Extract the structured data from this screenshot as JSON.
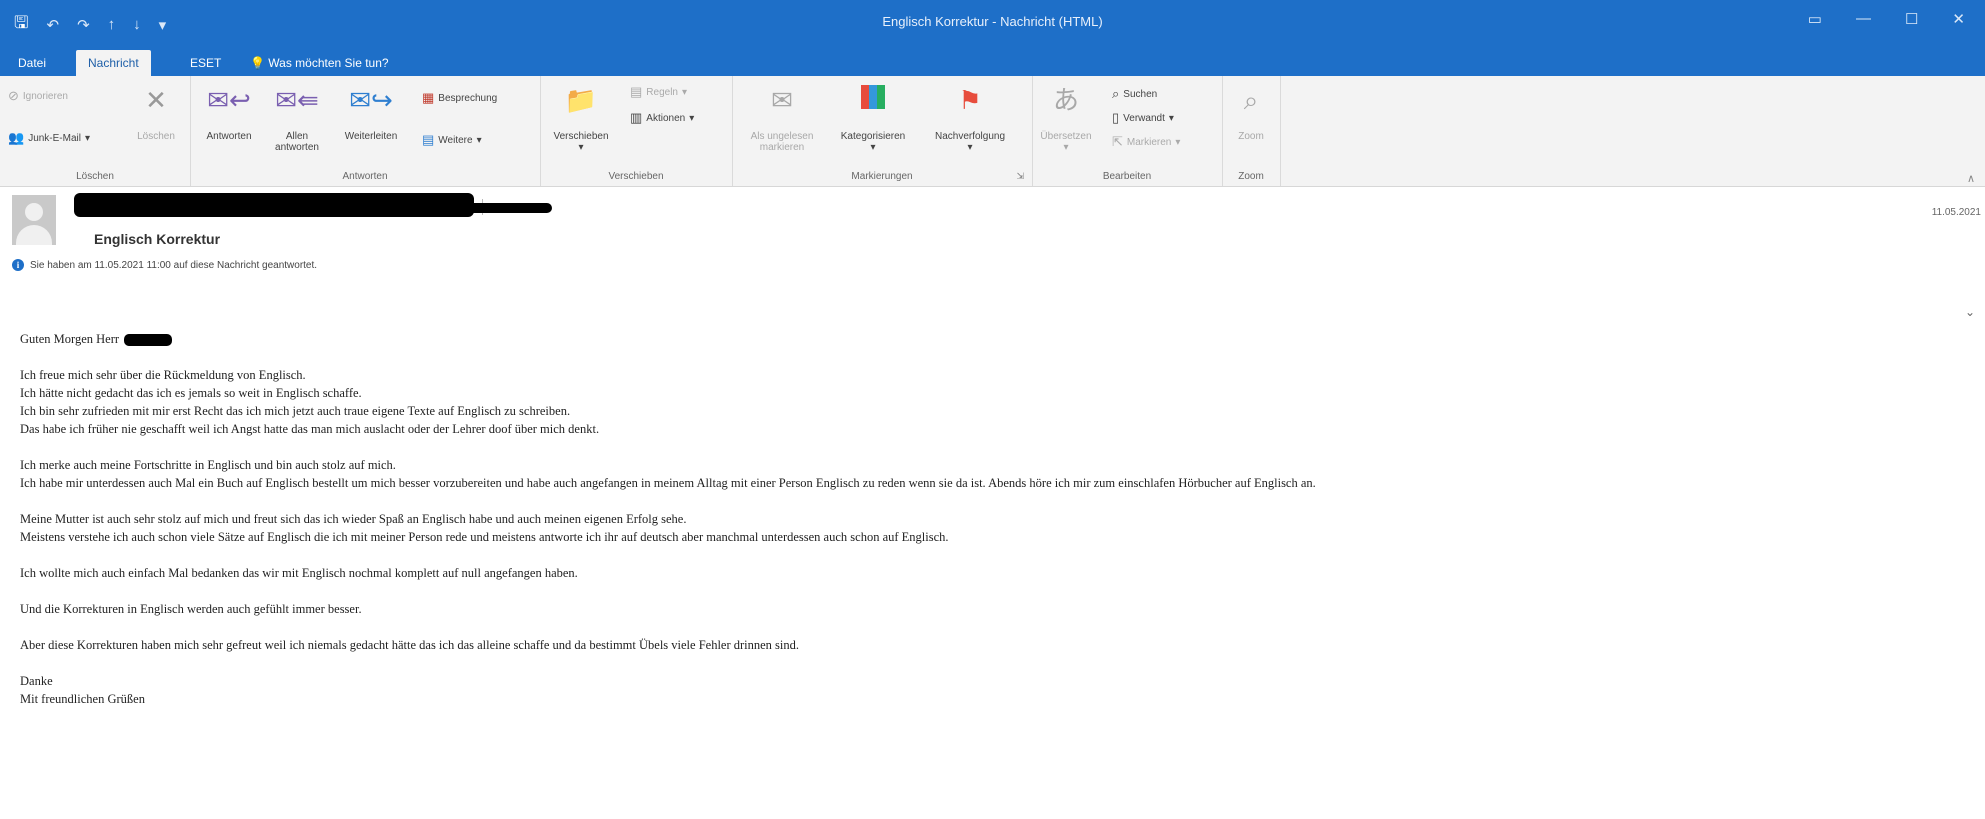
{
  "window": {
    "title": "Englisch Korrektur - Nachricht (HTML)"
  },
  "tabs": [
    {
      "label": "Datei"
    },
    {
      "label": "Nachricht"
    },
    {
      "label": "ESET"
    },
    {
      "label": "Was möchten Sie tun?"
    }
  ],
  "ribbon": {
    "loeschen": {
      "ignore": "Ignorieren",
      "junk": "Junk-E-Mail",
      "delete": "Löschen",
      "label": "Löschen"
    },
    "antworten": {
      "reply": "Antworten",
      "reply_all_1": "Allen",
      "reply_all_2": "antworten",
      "forward": "Weiterleiten",
      "meeting": "Besprechung",
      "more": "Weitere",
      "label": "Antworten"
    },
    "verschieben": {
      "move": "Verschieben",
      "rules": "Regeln",
      "actions": "Aktionen",
      "label": "Verschieben"
    },
    "markierungen": {
      "unread_1": "Als ungelesen",
      "unread_2": "markieren",
      "categorize": "Kategorisieren",
      "followup": "Nachverfolgung",
      "label": "Markierungen"
    },
    "bearbeiten": {
      "translate": "Übersetzen",
      "search": "Suchen",
      "related": "Verwandt",
      "select": "Markieren",
      "label": "Bearbeiten"
    },
    "zoom": {
      "zoom": "Zoom",
      "label": "Zoom"
    }
  },
  "message": {
    "subject": "Englisch Korrektur",
    "date": "11.05.2021",
    "info": "Sie haben am 11.05.2021 11:00 auf diese Nachricht geantwortet."
  },
  "body": {
    "greeting": "Guten Morgen Herr",
    "p1": [
      "Ich freue mich sehr über die Rückmeldung von Englisch.",
      "Ich hätte nicht gedacht das ich es jemals so weit in Englisch schaffe.",
      "Ich bin sehr zufrieden mit mir erst Recht das ich mich jetzt auch traue eigene Texte auf Englisch zu schreiben.",
      "Das habe ich früher nie geschafft weil ich Angst hatte das man mich auslacht oder der Lehrer doof über mich denkt."
    ],
    "p2": [
      "Ich merke auch meine Fortschritte in Englisch und bin auch stolz auf mich.",
      "Ich habe mir unterdessen auch Mal ein Buch auf Englisch bestellt um mich besser vorzubereiten und habe auch angefangen in meinem Alltag mit einer Person Englisch zu reden wenn sie da ist. Abends höre ich mir zum einschlafen Hörbucher auf Englisch an."
    ],
    "p3": [
      "Meine Mutter ist auch sehr stolz auf mich und freut sich das ich wieder Spaß an Englisch habe und auch meinen eigenen Erfolg sehe.",
      "Meistens verstehe ich auch schon viele Sätze auf Englisch die ich mit meiner Person rede und meistens antworte ich ihr auf deutsch aber manchmal unterdessen auch schon auf Englisch."
    ],
    "p4": "Ich wollte mich auch einfach Mal bedanken das wir mit Englisch nochmal komplett auf null angefangen haben.",
    "p5": "Und die Korrekturen in Englisch werden auch gefühlt immer besser.",
    "p6": "Aber diese Korrekturen haben mich sehr gefreut weil ich niemals gedacht hätte das ich das alleine schaffe und da bestimmt Übels viele Fehler drinnen sind.",
    "closing1": "Danke",
    "closing2": "Mit freundlichen Grüßen"
  }
}
